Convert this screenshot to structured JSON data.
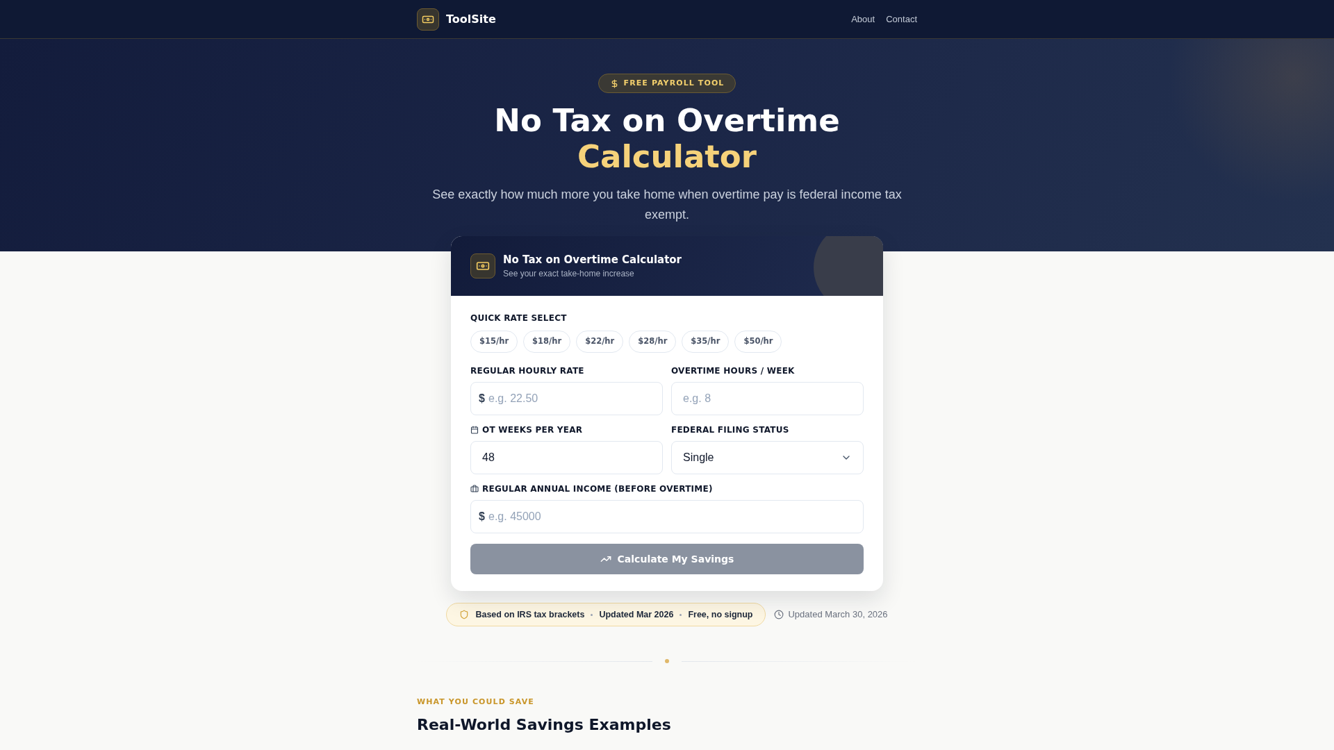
{
  "header": {
    "site_name": "ToolSite",
    "nav": [
      "About",
      "Contact"
    ]
  },
  "hero": {
    "tag": "FREE PAYROLL TOOL",
    "title": "No Tax on Overtime",
    "title_highlight": "Calculator",
    "subtitle": "See exactly how much more you take home when overtime pay is federal income tax exempt."
  },
  "calculator": {
    "title": "No Tax on Overtime Calculator",
    "subtitle": "See your exact take-home increase",
    "quick_rate": {
      "label": "QUICK RATE SELECT",
      "options": [
        {
          "label": "$15/hr",
          "selected": false
        },
        {
          "label": "$18/hr",
          "selected": false
        },
        {
          "label": "$22/hr",
          "selected": false
        },
        {
          "label": "$28/hr",
          "selected": false
        },
        {
          "label": "$35/hr",
          "selected": false
        },
        {
          "label": "$50/hr",
          "selected": false
        }
      ]
    },
    "fields": [
      {
        "kind": "input",
        "label": "REGULAR HOURLY RATE",
        "prefix": "$",
        "placeholder": "e.g. 22.50"
      },
      {
        "kind": "input",
        "label": "OVERTIME HOURS / WEEK",
        "placeholder": "e.g. 8"
      },
      {
        "kind": "input",
        "label": "OT WEEKS PER YEAR",
        "value": "48"
      },
      {
        "kind": "select",
        "label": "FEDERAL FILING STATUS",
        "value": "Single"
      },
      {
        "kind": "input",
        "label": "REGULAR ANNUAL INCOME (BEFORE OVERTIME)",
        "prefix": "$",
        "placeholder": "e.g. 45000"
      }
    ],
    "button": {
      "label": "Calculate My Savings",
      "disabled": true
    }
  },
  "trust": {
    "items": [
      "Based on IRS tax brackets",
      "Updated Mar 2026",
      "Free, no signup"
    ],
    "updated": "Updated March 30, 2026"
  },
  "section": {
    "eyebrow": "WHAT YOU COULD SAVE",
    "heading": "Real-World Savings Examples"
  }
}
